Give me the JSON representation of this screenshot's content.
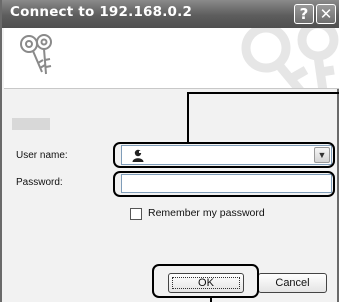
{
  "window": {
    "title": "Connect to 192.168.0.2",
    "help_glyph": "?",
    "close_glyph": "✕"
  },
  "form": {
    "user_label": "User name:",
    "user_value": "",
    "password_label": "Password:",
    "password_value": "",
    "remember_label": "Remember my password",
    "remember_checked": false
  },
  "buttons": {
    "ok": "OK",
    "cancel": "Cancel"
  },
  "icons": {
    "banner": "keys-icon",
    "combo_user": "user-icon",
    "combo_arrow": "chevron-down-icon"
  }
}
